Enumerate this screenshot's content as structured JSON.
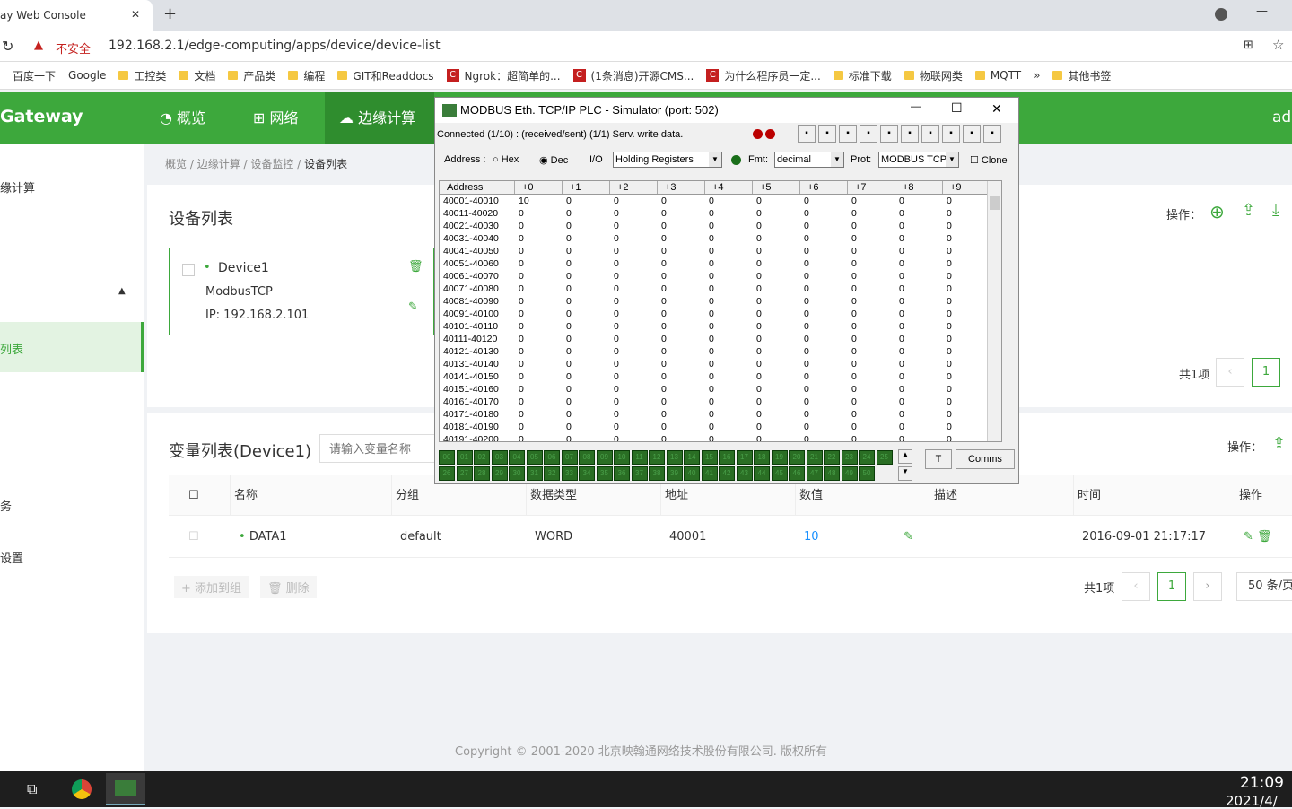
{
  "browser": {
    "tab_title": "ay Web Console",
    "new_tab": "+",
    "insecure": "不安全",
    "url": "192.168.2.1/edge-computing/apps/device/device-list",
    "bookmarks": [
      "百度一下",
      "Google",
      "工控类",
      "文档",
      "产品类",
      "编程",
      "GIT和Readdocs",
      "Ngrok：超简单的...",
      "(1条消息)开源CMS...",
      "为什么程序员一定...",
      "标准下载",
      "物联网类",
      "MQTT",
      "»",
      "其他书签"
    ]
  },
  "app": {
    "brand": "Gateway",
    "nav": [
      "概览",
      "网络",
      "边缘计算"
    ],
    "user": "ad",
    "sidebar": [
      "缘计算",
      "列表",
      "务",
      "设置"
    ],
    "breadcrumb": [
      "概览",
      "边缘计算",
      "设备监控",
      "设备列表"
    ],
    "device_section": {
      "title": "设备列表",
      "ops_label": "操作：",
      "pagination_total": "共1项",
      "page": "1",
      "device": {
        "name": "Device1",
        "protocol": "ModbusTCP",
        "ip": "IP: 192.168.2.101"
      }
    },
    "var_section": {
      "title": "变量列表(Device1)",
      "search_placeholder": "请输入变量名称",
      "ops_label": "操作：",
      "columns": [
        "名称",
        "分组",
        "数据类型",
        "地址",
        "数值",
        "描述",
        "时间",
        "操作"
      ],
      "rows": [
        {
          "name": "DATA1",
          "group": "default",
          "type": "WORD",
          "address": "40001",
          "value": "10",
          "desc": "",
          "time": "2016-09-01 21:17:17"
        }
      ],
      "add_to_group": "添加到组",
      "delete": "删除",
      "total": "共1项",
      "page": "1",
      "page_size": "50 条/页"
    },
    "copyright": "Copyright © 2001-2020 北京映翰通网络技术股份有限公司. 版权所有"
  },
  "simulator": {
    "title": "MODBUS Eth. TCP/IP PLC - Simulator (port: 502)",
    "status": "Connected (1/10) : (received/sent) (1/1) Serv. write data.",
    "address_label": "Address :",
    "hex": "Hex",
    "dec": "Dec",
    "address_mode": "Dec",
    "io_label": "I/O",
    "io": "Holding Registers",
    "fmt_label": "Fmt:",
    "fmt": "decimal",
    "prot_label": "Prot:",
    "prot": "MODBUS TCP",
    "clone": "Clone",
    "clone_checked": false,
    "columns": [
      "Address",
      "+0",
      "+1",
      "+2",
      "+3",
      "+4",
      "+5",
      "+6",
      "+7",
      "+8",
      "+9"
    ],
    "rows": [
      [
        "40001-40010",
        "10",
        "0",
        "0",
        "0",
        "0",
        "0",
        "0",
        "0",
        "0",
        "0"
      ],
      [
        "40011-40020",
        "0",
        "0",
        "0",
        "0",
        "0",
        "0",
        "0",
        "0",
        "0",
        "0"
      ],
      [
        "40021-40030",
        "0",
        "0",
        "0",
        "0",
        "0",
        "0",
        "0",
        "0",
        "0",
        "0"
      ],
      [
        "40031-40040",
        "0",
        "0",
        "0",
        "0",
        "0",
        "0",
        "0",
        "0",
        "0",
        "0"
      ],
      [
        "40041-40050",
        "0",
        "0",
        "0",
        "0",
        "0",
        "0",
        "0",
        "0",
        "0",
        "0"
      ],
      [
        "40051-40060",
        "0",
        "0",
        "0",
        "0",
        "0",
        "0",
        "0",
        "0",
        "0",
        "0"
      ],
      [
        "40061-40070",
        "0",
        "0",
        "0",
        "0",
        "0",
        "0",
        "0",
        "0",
        "0",
        "0"
      ],
      [
        "40071-40080",
        "0",
        "0",
        "0",
        "0",
        "0",
        "0",
        "0",
        "0",
        "0",
        "0"
      ],
      [
        "40081-40090",
        "0",
        "0",
        "0",
        "0",
        "0",
        "0",
        "0",
        "0",
        "0",
        "0"
      ],
      [
        "40091-40100",
        "0",
        "0",
        "0",
        "0",
        "0",
        "0",
        "0",
        "0",
        "0",
        "0"
      ],
      [
        "40101-40110",
        "0",
        "0",
        "0",
        "0",
        "0",
        "0",
        "0",
        "0",
        "0",
        "0"
      ],
      [
        "40111-40120",
        "0",
        "0",
        "0",
        "0",
        "0",
        "0",
        "0",
        "0",
        "0",
        "0"
      ],
      [
        "40121-40130",
        "0",
        "0",
        "0",
        "0",
        "0",
        "0",
        "0",
        "0",
        "0",
        "0"
      ],
      [
        "40131-40140",
        "0",
        "0",
        "0",
        "0",
        "0",
        "0",
        "0",
        "0",
        "0",
        "0"
      ],
      [
        "40141-40150",
        "0",
        "0",
        "0",
        "0",
        "0",
        "0",
        "0",
        "0",
        "0",
        "0"
      ],
      [
        "40151-40160",
        "0",
        "0",
        "0",
        "0",
        "0",
        "0",
        "0",
        "0",
        "0",
        "0"
      ],
      [
        "40161-40170",
        "0",
        "0",
        "0",
        "0",
        "0",
        "0",
        "0",
        "0",
        "0",
        "0"
      ],
      [
        "40171-40180",
        "0",
        "0",
        "0",
        "0",
        "0",
        "0",
        "0",
        "0",
        "0",
        "0"
      ],
      [
        "40181-40190",
        "0",
        "0",
        "0",
        "0",
        "0",
        "0",
        "0",
        "0",
        "0",
        "0"
      ],
      [
        "40191-40200",
        "0",
        "0",
        "0",
        "0",
        "0",
        "0",
        "0",
        "0",
        "0",
        "0"
      ]
    ],
    "leds": [
      "00",
      "01",
      "02",
      "03",
      "04",
      "05",
      "06",
      "07",
      "08",
      "09",
      "10",
      "11",
      "12",
      "13",
      "14",
      "15",
      "16",
      "17",
      "18",
      "19",
      "20",
      "21",
      "22",
      "23",
      "24",
      "25",
      "26",
      "27",
      "28",
      "29",
      "30",
      "31",
      "32",
      "33",
      "34",
      "35",
      "36",
      "37",
      "38",
      "39",
      "40",
      "41",
      "42",
      "43",
      "44",
      "45",
      "46",
      "47",
      "48",
      "49",
      "50"
    ],
    "t_button": "T",
    "comms_button": "Comms"
  },
  "taskbar": {
    "time": "21:09",
    "date": "2021/4/"
  },
  "colors": {
    "brand": "#3da83c",
    "led": "#2a6e24"
  }
}
